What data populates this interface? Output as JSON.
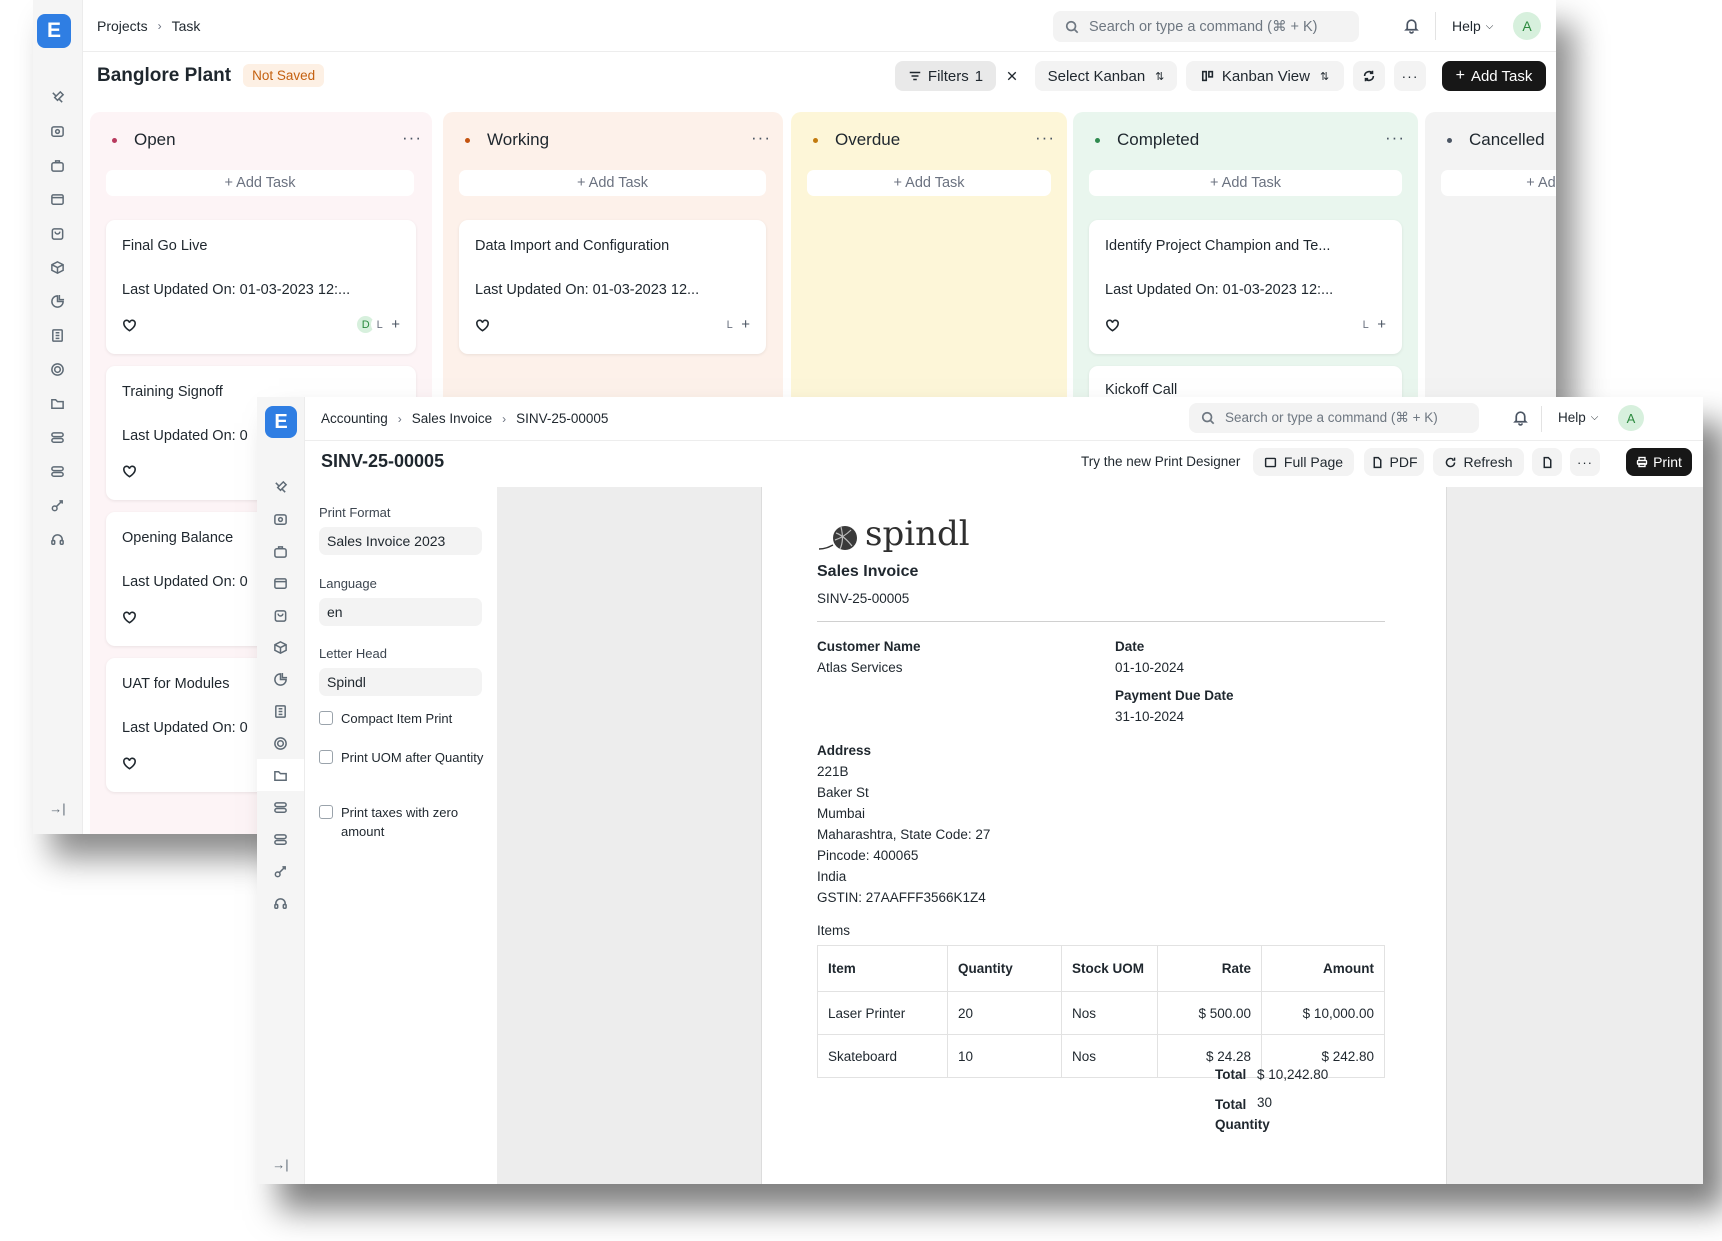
{
  "kanban_window": {
    "logo": "E",
    "breadcrumbs": [
      "Projects",
      "Task"
    ],
    "search_placeholder": "Search or type a command (⌘ + K)",
    "help_label": "Help",
    "avatar_initial": "A",
    "title": "Banglore Plant",
    "status": "Not Saved",
    "toolbar": {
      "filters_label": "Filters",
      "filters_count": "1",
      "select_kanban_label": "Select Kanban",
      "kanban_view_label": "Kanban View",
      "more_label": "···",
      "add_task_label": "Add Task"
    },
    "columns": [
      {
        "name": "Open",
        "bg": "#fdf4f6",
        "dot": "#b83a5e",
        "add_label": "+ Add Task",
        "cards": [
          {
            "title": "Final Go Live",
            "updated": "Last Updated On: 01-03-2023 12:...",
            "assignees": [
              "D",
              "L"
            ]
          },
          {
            "title": "Training Signoff",
            "updated": "Last Updated On: 0"
          },
          {
            "title": "Opening Balance",
            "updated": "Last Updated On: 0"
          },
          {
            "title": "UAT for Modules",
            "updated": "Last Updated On: 0"
          }
        ]
      },
      {
        "name": "Working",
        "bg": "#fdf1ea",
        "dot": "#c4530f",
        "add_label": "+ Add Task",
        "cards": [
          {
            "title": "Data Import and Configuration",
            "updated": "Last Updated On: 01-03-2023 12...",
            "assignees": [
              "L"
            ]
          }
        ]
      },
      {
        "name": "Overdue",
        "bg": "#fdf6d8",
        "dot": "#c27a0e",
        "add_label": "+ Add Task",
        "cards": []
      },
      {
        "name": "Completed",
        "bg": "#e9f6ee",
        "dot": "#2f8a4f",
        "add_label": "+ Add Task",
        "cards": [
          {
            "title": "Identify Project Champion and Te...",
            "updated": "Last Updated On: 01-03-2023 12:...",
            "assignees": [
              "L"
            ]
          },
          {
            "title": "Kickoff Call",
            "updated": ""
          }
        ]
      },
      {
        "name": "Cancelled",
        "bg": "#f3f3f3",
        "dot": "#4b5563",
        "add_label": "+ Ad",
        "cards": []
      }
    ]
  },
  "invoice_window": {
    "logo": "E",
    "breadcrumbs": [
      "Accounting",
      "Sales Invoice",
      "SINV-25-00005"
    ],
    "search_placeholder": "Search or type a command (⌘ + K)",
    "help_label": "Help",
    "avatar_initial": "A",
    "title": "SINV-25-00005",
    "try_new_label": "Try the new Print Designer",
    "toolbar": {
      "full_page_label": "Full Page",
      "pdf_label": "PDF",
      "refresh_label": "Refresh",
      "more_label": "···",
      "print_label": "Print"
    },
    "settings": {
      "print_format_label": "Print Format",
      "print_format_value": "Sales Invoice 2023",
      "language_label": "Language",
      "language_value": "en",
      "letter_head_label": "Letter Head",
      "letter_head_value": "Spindl",
      "checkboxes": [
        {
          "label": "Compact Item Print",
          "checked": false
        },
        {
          "label": "Print UOM after Quantity",
          "checked": false
        },
        {
          "label": "Print taxes with zero amount",
          "checked": false
        }
      ]
    },
    "document": {
      "brand": "spindl",
      "doc_title": "Sales Invoice",
      "doc_number": "SINV-25-00005",
      "customer_name_label": "Customer Name",
      "customer_name": "Atlas Services",
      "date_label": "Date",
      "date": "01-10-2024",
      "due_date_label": "Payment Due Date",
      "due_date": "31-10-2024",
      "address_label": "Address",
      "address_lines": [
        "221B",
        "Baker St",
        "Mumbai",
        "Maharashtra, State Code: 27",
        "Pincode: 400065",
        "India",
        "GSTIN: 27AAFFF3566K1Z4"
      ],
      "items_label": "Items",
      "item_headers": [
        "Item",
        "Quantity",
        "Stock UOM",
        "Rate",
        "Amount"
      ],
      "items": [
        [
          "Laser Printer",
          "20",
          "Nos",
          "$ 500.00",
          "$ 10,000.00"
        ],
        [
          "Skateboard",
          "10",
          "Nos",
          "$ 24.28",
          "$ 242.80"
        ]
      ],
      "total_label": "Total",
      "total": "$ 10,242.80",
      "total_qty_label": "Total Quantity",
      "total_qty": "30"
    }
  }
}
